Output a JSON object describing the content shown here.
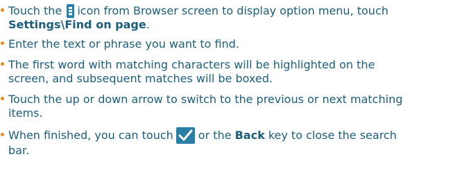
{
  "bullets": [
    {
      "lines": [
        {
          "before": "Touch the",
          "after": "icon from Browser screen to display option menu, touch"
        },
        {
          "bold": "Settings\\Find on page",
          "after": "."
        }
      ]
    },
    {
      "lines": [
        {
          "text": "Enter the text or phrase you want to find."
        }
      ]
    },
    {
      "lines": [
        {
          "text": "The first word with matching characters will be highlighted on the"
        },
        {
          "text": "screen, and subsequent matches will be boxed."
        }
      ]
    },
    {
      "lines": [
        {
          "text": "Touch the up or down arrow to switch to the previous or next matching"
        },
        {
          "text": "items."
        }
      ]
    },
    {
      "lines": [
        {
          "before": "When finished, you can touch",
          "middle": "or the",
          "bold": "Back",
          "after": "key to close the search"
        },
        {
          "text": "bar."
        }
      ]
    }
  ],
  "icons": {
    "menu": "menu-icon",
    "check": "check-icon"
  },
  "colors": {
    "text": "#1a5e7c",
    "bullet": "#f08a1c",
    "icon_bg": "#2a7fa6",
    "icon_fg": "#ffffff"
  }
}
